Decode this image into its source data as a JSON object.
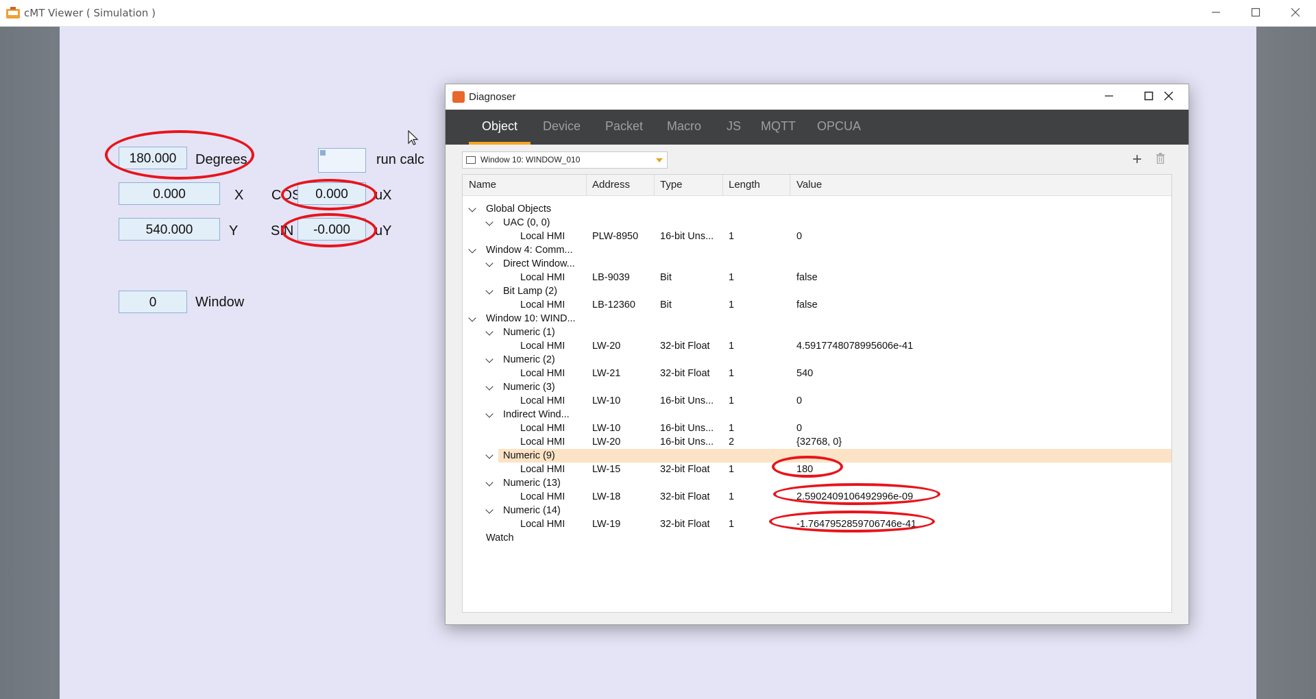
{
  "app": {
    "title": "cMT Viewer ( Simulation )",
    "min_icon": "minimize-icon",
    "max_icon": "maximize-icon",
    "close_icon": "close-icon"
  },
  "hmi": {
    "degrees_value": "180.000",
    "degrees_label": "Degrees",
    "run_calc_label": "run calc",
    "x_value": "0.000",
    "x_label": "X",
    "cos_label": "COS",
    "cos_value": "0.000",
    "ux_label": "uX",
    "y_value": "540.000",
    "y_label": "Y",
    "sin_label": "SIN",
    "sin_value": "-0.000",
    "uy_label": "uY",
    "window_value": "0",
    "window_label": "Window"
  },
  "diagnoser": {
    "title": "Diagnoser",
    "tabs": [
      {
        "label": "Object",
        "active": true
      },
      {
        "label": "Device"
      },
      {
        "label": "Packet"
      },
      {
        "label": "Macro"
      },
      {
        "label": "JS"
      },
      {
        "label": "MQTT"
      },
      {
        "label": "OPCUA"
      }
    ],
    "window_select": "Window 10: WINDOW_010",
    "add_label": "+",
    "columns": [
      "Name",
      "Address",
      "Type",
      "Length",
      "Value"
    ],
    "rows": [
      {
        "indent": 0,
        "expand": true,
        "name": "Global Objects"
      },
      {
        "indent": 1,
        "expand": true,
        "name": "UAC (0, 0)"
      },
      {
        "indent": 2,
        "name": "Local HMI",
        "address": "PLW-8950",
        "type": "16-bit Uns...",
        "length": "1",
        "value": "0"
      },
      {
        "indent": 0,
        "expand": true,
        "name": "Window 4: Comm..."
      },
      {
        "indent": 1,
        "expand": true,
        "name": "Direct Window..."
      },
      {
        "indent": 2,
        "name": "Local HMI",
        "address": "LB-9039",
        "type": "Bit",
        "length": "1",
        "value": "false"
      },
      {
        "indent": 1,
        "expand": true,
        "name": "Bit Lamp (2)"
      },
      {
        "indent": 2,
        "name": "Local HMI",
        "address": "LB-12360",
        "type": "Bit",
        "length": "1",
        "value": "false"
      },
      {
        "indent": 0,
        "expand": true,
        "name": "Window 10: WIND..."
      },
      {
        "indent": 1,
        "expand": true,
        "name": "Numeric (1)"
      },
      {
        "indent": 2,
        "name": "Local HMI",
        "address": "LW-20",
        "type": "32-bit Float",
        "length": "1",
        "value": "4.5917748078995606e-41"
      },
      {
        "indent": 1,
        "expand": true,
        "name": "Numeric (2)"
      },
      {
        "indent": 2,
        "name": "Local HMI",
        "address": "LW-21",
        "type": "32-bit Float",
        "length": "1",
        "value": "540"
      },
      {
        "indent": 1,
        "expand": true,
        "name": "Numeric (3)"
      },
      {
        "indent": 2,
        "name": "Local HMI",
        "address": "LW-10",
        "type": "16-bit Uns...",
        "length": "1",
        "value": "0"
      },
      {
        "indent": 1,
        "expand": true,
        "name": "Indirect Wind..."
      },
      {
        "indent": 2,
        "name": "Local HMI",
        "address": "LW-10",
        "type": "16-bit Uns...",
        "length": "1",
        "value": "0"
      },
      {
        "indent": 2,
        "name": "Local HMI",
        "address": "LW-20",
        "type": "16-bit Uns...",
        "length": "2",
        "value": "{32768, 0}"
      },
      {
        "indent": 1,
        "expand": true,
        "name": "Numeric (9)",
        "selected": true
      },
      {
        "indent": 2,
        "name": "Local HMI",
        "address": "LW-15",
        "type": "32-bit Float",
        "length": "1",
        "value": "180"
      },
      {
        "indent": 1,
        "expand": true,
        "name": "Numeric (13)"
      },
      {
        "indent": 2,
        "name": "Local HMI",
        "address": "LW-18",
        "type": "32-bit Float",
        "length": "1",
        "value": "2.5902409106492996e-09"
      },
      {
        "indent": 1,
        "expand": true,
        "name": "Numeric (14)"
      },
      {
        "indent": 2,
        "name": "Local HMI",
        "address": "LW-19",
        "type": "32-bit Float",
        "length": "1",
        "value": "-1.7647952859706746e-41"
      },
      {
        "indent": 0,
        "name": "Watch"
      }
    ]
  },
  "colors": {
    "annotation": "#e8141b",
    "tab_accent": "#f5a623",
    "selected_row": "#fce3c6"
  }
}
